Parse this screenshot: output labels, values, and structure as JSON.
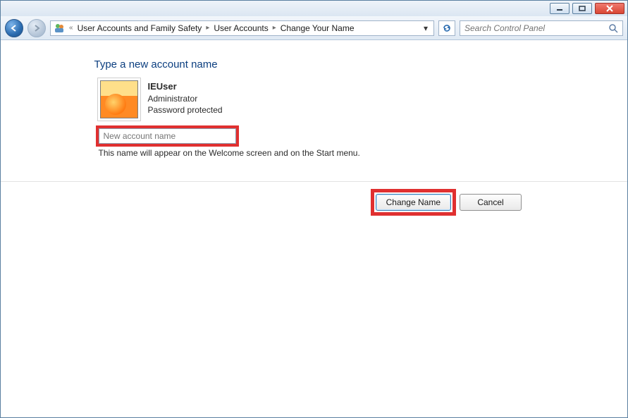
{
  "window_controls": {
    "minimize_title": "Minimize",
    "maximize_title": "Maximize",
    "close_title": "Close"
  },
  "breadcrumbs": {
    "overflow": "«",
    "b1": "User Accounts and Family Safety",
    "b2": "User Accounts",
    "b3": "Change Your Name"
  },
  "search": {
    "placeholder": "Search Control Panel"
  },
  "page": {
    "heading": "Type a new account name",
    "hint": "This name will appear on the Welcome screen and on the Start menu."
  },
  "user": {
    "name": "IEUser",
    "role": "Administrator",
    "status": "Password protected"
  },
  "input": {
    "placeholder": "New account name",
    "value": ""
  },
  "buttons": {
    "change": "Change Name",
    "cancel": "Cancel"
  }
}
